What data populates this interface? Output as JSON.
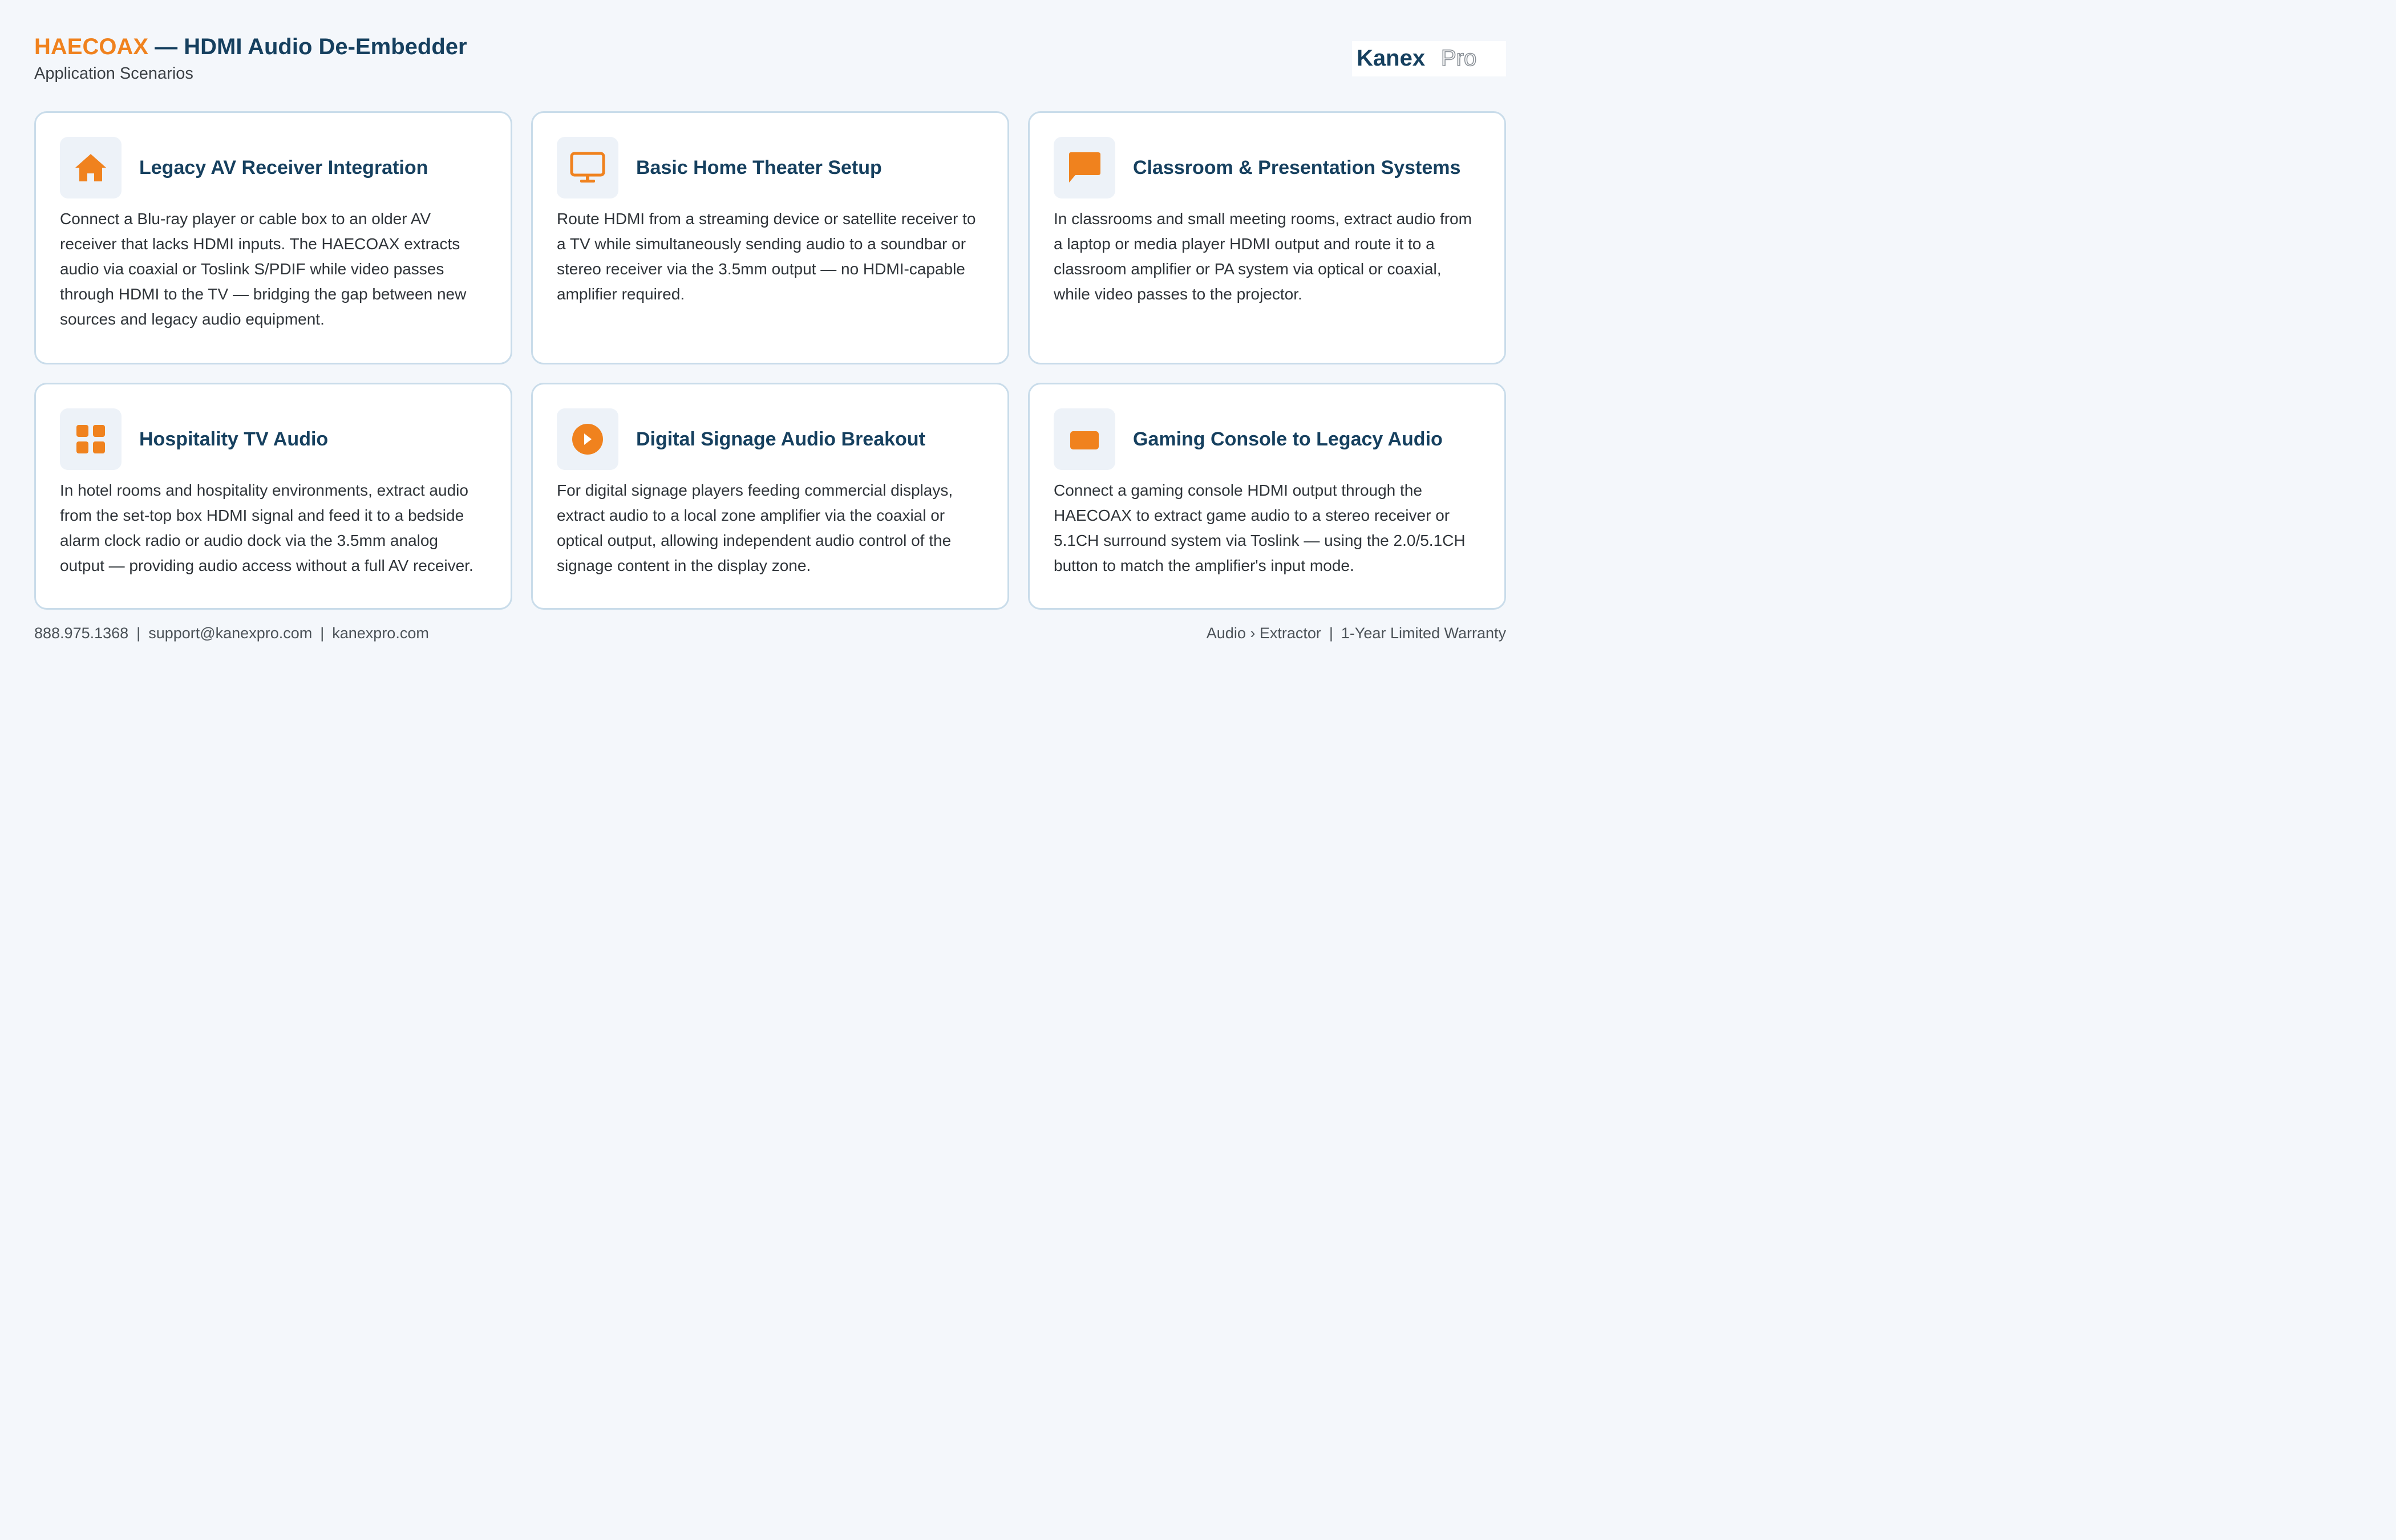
{
  "header": {
    "brand": "HAECOAX",
    "title_rest": " — HDMI Audio De-Embedder",
    "subtitle": "Application Scenarios",
    "logo_bold": "Kanex",
    "logo_light": "Pro"
  },
  "colors": {
    "accent": "#f0821e",
    "heading": "#16405f",
    "card_border": "#c9dcea",
    "icon_bg": "#edf2f8",
    "page_bg": "#f4f7fb"
  },
  "cards": [
    {
      "icon": "home-icon",
      "title": "Legacy AV Receiver Integration",
      "body": "Connect a Blu-ray player or cable box to an older AV receiver that lacks HDMI inputs. The HAECOAX extracts audio via coaxial or Toslink S/PDIF while video passes through HDMI to the TV — bridging the gap between new sources and legacy audio equipment."
    },
    {
      "icon": "monitor-icon",
      "title": "Basic Home Theater Setup",
      "body": "Route HDMI from a streaming device or satellite receiver to a TV while simultaneously sending audio to a soundbar or stereo receiver via the 3.5mm output — no HDMI-capable amplifier required."
    },
    {
      "icon": "chat-bubble-icon",
      "title": "Classroom & Presentation Systems",
      "body": "In classrooms and small meeting rooms, extract audio from a laptop or media player HDMI output and route it to a classroom amplifier or PA system via optical or coaxial, while video passes to the projector."
    },
    {
      "icon": "grid-icon",
      "title": "Hospitality TV Audio",
      "body": "In hotel rooms and hospitality environments, extract audio from the set-top box HDMI signal and feed it to a bedside alarm clock radio or audio dock via the 3.5mm analog output — providing audio access without a full AV receiver."
    },
    {
      "icon": "play-circle-icon",
      "title": "Digital Signage Audio Breakout",
      "body": "For digital signage players feeding commercial displays, extract audio to a local zone amplifier via the coaxial or optical output, allowing independent audio control of the signage content in the display zone."
    },
    {
      "icon": "rectangle-icon",
      "title": "Gaming Console to Legacy Audio",
      "body": "Connect a gaming console HDMI output through the HAECOAX to extract game audio to a stereo receiver or 5.1CH surround system via Toslink — using the 2.0/5.1CH button to match the amplifier's input mode."
    }
  ],
  "footer": {
    "phone": "888.975.1368",
    "email": "support@kanexpro.com",
    "website": "kanexpro.com",
    "separator": "|",
    "category": "Audio › Extractor",
    "warranty": "1-Year Limited Warranty"
  }
}
